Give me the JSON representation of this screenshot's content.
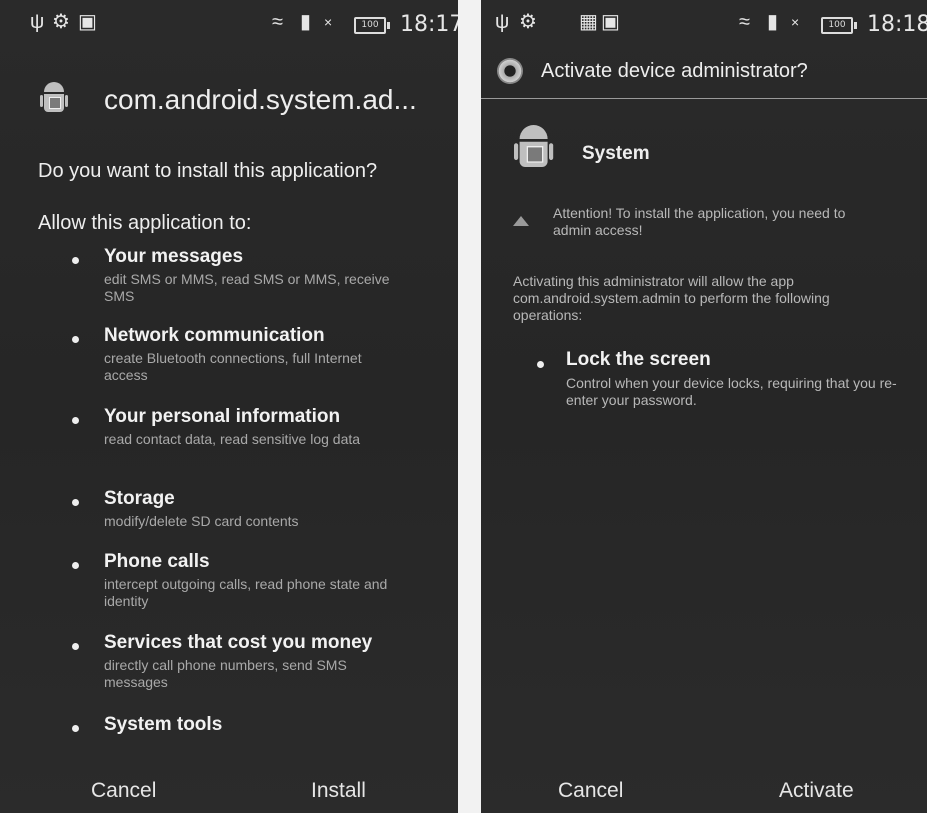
{
  "left": {
    "status": {
      "time": "18:17",
      "battery": "100"
    },
    "app_title": "com.android.system.ad...",
    "question": "Do you want to install this application?",
    "allow_heading": "Allow this application to:",
    "permissions": [
      {
        "title": "Your messages",
        "desc": "edit SMS or MMS, read SMS or MMS, receive SMS"
      },
      {
        "title": "Network communication",
        "desc": "create Bluetooth connections, full Internet access"
      },
      {
        "title": "Your personal information",
        "desc": "read contact data, read sensitive log data"
      },
      {
        "title": "Storage",
        "desc": "modify/delete SD card contents"
      },
      {
        "title": "Phone calls",
        "desc": "intercept outgoing calls, read phone state and identity"
      },
      {
        "title": "Services that cost you money",
        "desc": "directly call phone numbers, send SMS messages"
      },
      {
        "title": "System tools",
        "desc": ""
      }
    ],
    "buttons": {
      "cancel": "Cancel",
      "install": "Install"
    }
  },
  "right": {
    "status": {
      "time": "18:18",
      "battery": "100"
    },
    "dialog_title": "Activate device administrator?",
    "app_name": "System",
    "attention": "Attention! To install the application, you need to admin access!",
    "activating_text": "Activating this administrator will allow the app com.android.system.admin to perform the following operations:",
    "operation": {
      "title": "Lock the screen",
      "desc": "Control when your device locks, requiring that you re-enter your password."
    },
    "buttons": {
      "cancel": "Cancel",
      "activate": "Activate"
    }
  },
  "icons": {
    "statusbar": [
      "usb-icon",
      "android-debug-icon",
      "bag-icon",
      "gallery-icon",
      "wifi-icon",
      "sim-icon",
      "signal-icon",
      "battery-icon"
    ],
    "app": "android-app-icon",
    "dialog": "gear-icon",
    "warning": "warning-icon"
  }
}
